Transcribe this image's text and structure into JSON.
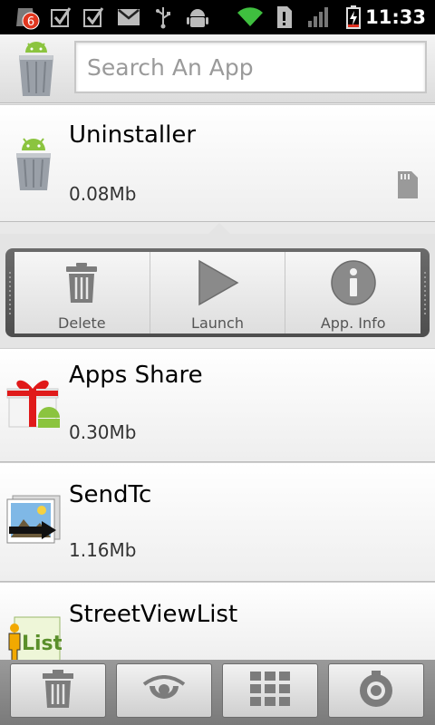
{
  "status_bar": {
    "notification_count": "6",
    "time": "11:33",
    "icons": [
      "notification-badge-icon",
      "checkbox-icon",
      "checkbox-icon",
      "gmail-icon",
      "usb-icon",
      "android-debug-icon",
      "wifi-icon",
      "alert-icon",
      "signal-icon",
      "battery-charging-icon"
    ]
  },
  "header": {
    "logo_icon": "uninstaller-trash-can-icon",
    "search_placeholder": "Search An App"
  },
  "apps": [
    {
      "name": "Uninstaller",
      "size": "0.08Mb",
      "icon": "android-trash-can-icon",
      "storage_icon": "sd-card-icon"
    },
    {
      "name": "Apps Share",
      "size": "0.30Mb",
      "icon": "gift-box-icon"
    },
    {
      "name": "SendTc",
      "size": "1.16Mb",
      "icon": "picture-send-icon"
    },
    {
      "name": "StreetViewList",
      "size": "",
      "icon": "list-person-icon"
    }
  ],
  "actions": [
    {
      "label": "Delete",
      "icon": "trash-icon"
    },
    {
      "label": "Launch",
      "icon": "play-icon"
    },
    {
      "label": "App. Info",
      "icon": "info-icon"
    }
  ],
  "bottom_bar": [
    {
      "icon": "trash-icon"
    },
    {
      "icon": "eye-icon"
    },
    {
      "icon": "grid-icon"
    },
    {
      "icon": "settings-icon"
    }
  ],
  "colors": {
    "status_bar": "#000000",
    "list_background": "#e9e9e9",
    "action_frame": "#5a5a5a",
    "notification_badge": "#e0371f"
  }
}
